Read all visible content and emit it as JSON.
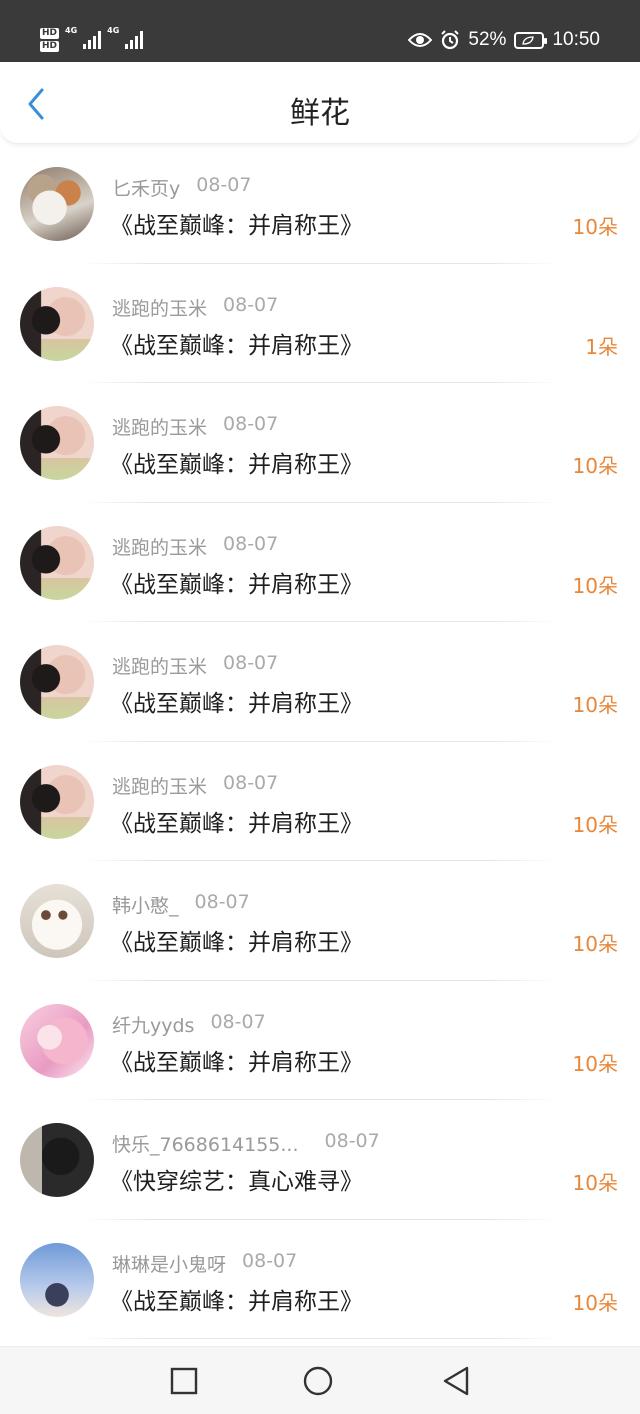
{
  "status_bar": {
    "hd1": "HD",
    "hd2": "HD",
    "net1": "4G",
    "net2": "4G",
    "battery_percent": "52%",
    "time": "10:50"
  },
  "header": {
    "title": "鲜花",
    "back_icon": "chevron-left-icon",
    "accent_color": "#3b8fd9"
  },
  "list": {
    "count_color": "#e8873a",
    "items": [
      {
        "user": "匕禾页y",
        "date": "08-07",
        "book": "《战至巅峰：并肩称王》",
        "count": "10朵",
        "avatar": "cat-avatar"
      },
      {
        "user": "逃跑的玉米",
        "date": "08-07",
        "book": "《战至巅峰：并肩称王》",
        "count": "1朵",
        "avatar": "girl-avatar"
      },
      {
        "user": "逃跑的玉米",
        "date": "08-07",
        "book": "《战至巅峰：并肩称王》",
        "count": "10朵",
        "avatar": "girl-avatar"
      },
      {
        "user": "逃跑的玉米",
        "date": "08-07",
        "book": "《战至巅峰：并肩称王》",
        "count": "10朵",
        "avatar": "girl-avatar"
      },
      {
        "user": "逃跑的玉米",
        "date": "08-07",
        "book": "《战至巅峰：并肩称王》",
        "count": "10朵",
        "avatar": "girl-avatar"
      },
      {
        "user": "逃跑的玉米",
        "date": "08-07",
        "book": "《战至巅峰：并肩称王》",
        "count": "10朵",
        "avatar": "girl-avatar"
      },
      {
        "user": "韩小憨_",
        "date": "08-07",
        "book": "《战至巅峰：并肩称王》",
        "count": "10朵",
        "avatar": "white-cat-avatar"
      },
      {
        "user": "纤九yyds",
        "date": "08-07",
        "book": "《战至巅峰：并肩称王》",
        "count": "10朵",
        "avatar": "anime-avatar"
      },
      {
        "user": "快乐_7668614155...",
        "date": "08-07",
        "book": "《快穿综艺：真心难寻》",
        "count": "10朵",
        "avatar": "dark-avatar"
      },
      {
        "user": "琳琳是小鬼呀",
        "date": "08-07",
        "book": "《战至巅峰：并肩称王》",
        "count": "10朵",
        "avatar": "sky-avatar"
      }
    ]
  },
  "nav_bar": {
    "recents_icon": "square-icon",
    "home_icon": "circle-icon",
    "back_icon": "triangle-back-icon"
  }
}
